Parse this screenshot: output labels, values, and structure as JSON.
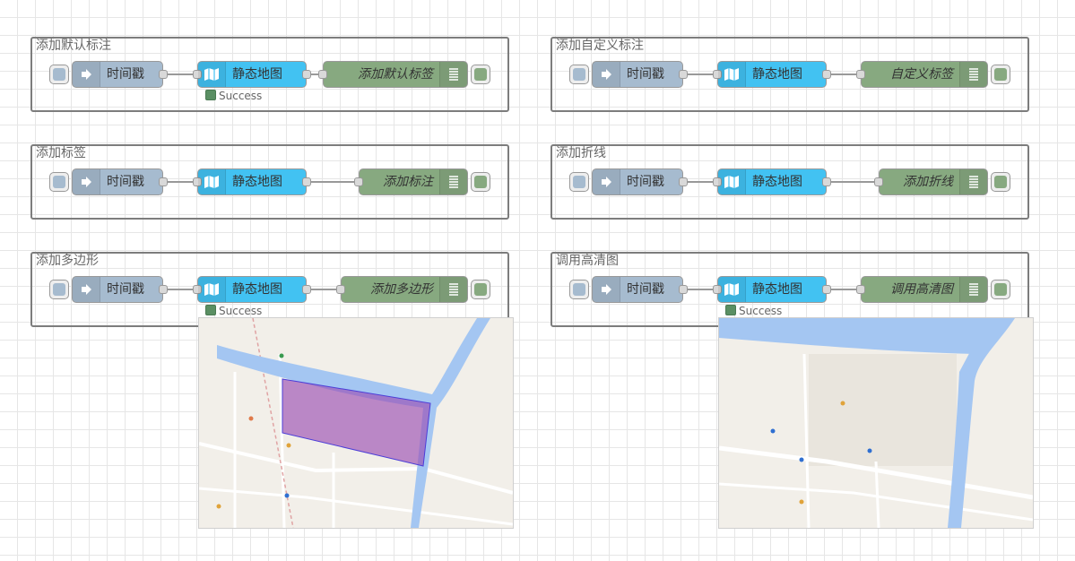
{
  "groups": [
    {
      "label": "添加默认标注",
      "inject_label": "时间戳",
      "map_label": "静态地图",
      "debug_label": "添加默认标签",
      "status": "Success"
    },
    {
      "label": "添加自定义标注",
      "inject_label": "时间戳",
      "map_label": "静态地图",
      "debug_label": "自定义标签"
    },
    {
      "label": "添加标签",
      "inject_label": "时间戳",
      "map_label": "静态地图",
      "debug_label": "添加标注"
    },
    {
      "label": "添加折线",
      "inject_label": "时间戳",
      "map_label": "静态地图",
      "debug_label": "添加折线"
    },
    {
      "label": "添加多边形",
      "inject_label": "时间戳",
      "map_label": "静态地图",
      "debug_label": "添加多边形",
      "status": "Success"
    },
    {
      "label": "调用高清图",
      "inject_label": "时间戳",
      "map_label": "静态地图",
      "debug_label": "调用高清图",
      "status": "Success"
    }
  ],
  "colors": {
    "inject": "#a6bbcf",
    "map": "#42c2f2",
    "debug": "#87a980",
    "status_ok": "#5a8f63",
    "map_water": "#a4c6f2",
    "polygon": "#9b4fb3"
  },
  "icons": [
    "arrow-right-icon",
    "folded-map-icon",
    "list-lines-icon"
  ]
}
